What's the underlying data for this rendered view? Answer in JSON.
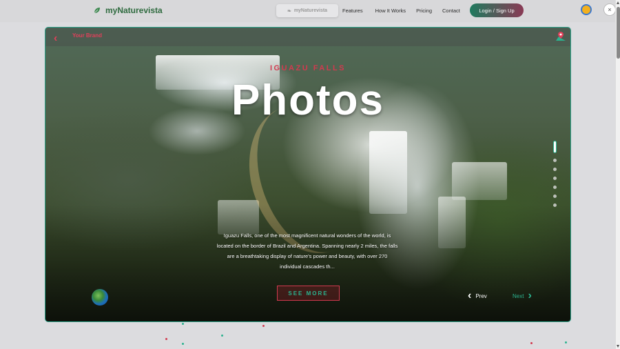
{
  "header": {
    "brand_prefix": "my",
    "brand_name": "Naturevista",
    "pill_label": "myNaturevista",
    "nav": [
      "Features",
      "How It Works",
      "Pricing",
      "Contact"
    ],
    "login_label": "Login / Sign Up",
    "close_label": "×"
  },
  "card": {
    "back_label": "‹",
    "brand_label": "Your Brand",
    "subtitle": "IGUAZU FALLS",
    "title": "Photos",
    "description": "Iguazu Falls, one of the most magnificent natural wonders of the world, is located on the border of Brazil and Argentina. Spanning nearly 2 miles, the falls are a breathtaking display of nature's power and beauty, with over 270 individual cascades th...",
    "see_more_label": "SEE MORE",
    "prev_label": "Prev",
    "next_label": "Next",
    "slide_count": 7,
    "active_slide": 1
  },
  "colors": {
    "accent_green": "#2bb38f",
    "accent_red": "#d23a4f",
    "brand_green": "#2f6b3f"
  },
  "icons": {
    "brand": "leaf-icon",
    "back": "chevron-left-icon",
    "map": "map-pin-icon",
    "globe": "globe-icon",
    "prev": "chevron-left-icon",
    "next": "chevron-right-icon",
    "extension": "extension-icon"
  }
}
